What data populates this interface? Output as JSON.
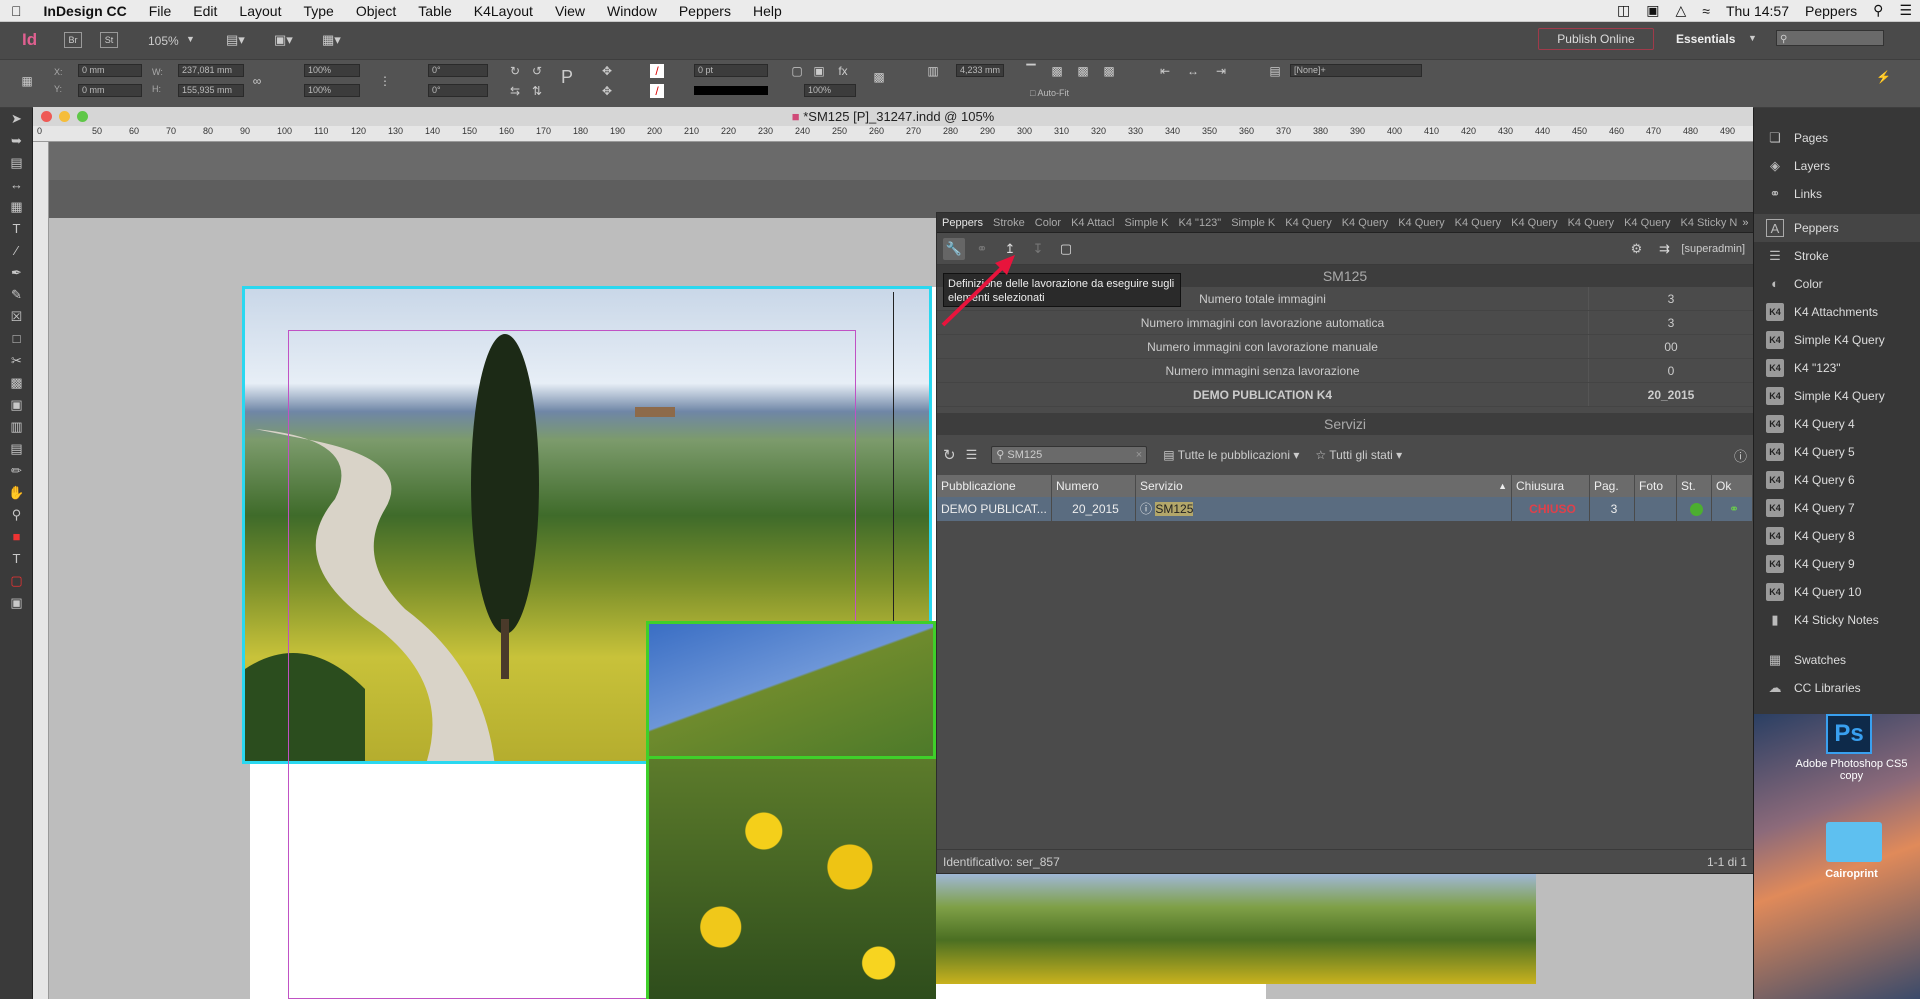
{
  "menubar": {
    "app": "InDesign CC",
    "items": [
      "File",
      "Edit",
      "Layout",
      "Type",
      "Object",
      "Table",
      "K4Layout",
      "View",
      "Window",
      "Peppers",
      "Help"
    ],
    "clock": "Thu 14:57",
    "user": "Peppers"
  },
  "control": {
    "zoom": "105%",
    "x": "0 mm",
    "y": "0 mm",
    "w": "237,081 mm",
    "h": "155,935 mm",
    "scale_x": "100%",
    "scale_y": "100%",
    "rotate": "0°",
    "shear": "0°",
    "stroke_weight": "0 pt",
    "opacity": "100%",
    "gap": "4,233 mm",
    "autofit": "Auto-Fit",
    "style": "[None]+",
    "publish": "Publish Online",
    "workspace": "Essentials"
  },
  "document": {
    "title": "*SM125 [P]_31247.indd @ 105%",
    "ruler": [
      "0",
      "50",
      "60",
      "70",
      "80",
      "90",
      "100",
      "110",
      "120",
      "130",
      "140",
      "150",
      "160",
      "170",
      "180",
      "190",
      "200",
      "210",
      "220",
      "230",
      "240",
      "250",
      "260",
      "270",
      "280",
      "290",
      "300",
      "310",
      "320",
      "330",
      "340",
      "350",
      "360",
      "370",
      "380",
      "390",
      "400",
      "410",
      "420",
      "430",
      "440",
      "450",
      "460",
      "470",
      "480",
      "490"
    ]
  },
  "panel": {
    "tabs": [
      "Peppers",
      "Stroke",
      "Color",
      "K4 Attacl",
      "Simple K",
      "K4 \"123\"",
      "Simple K",
      "K4 Query",
      "K4 Query",
      "K4 Query",
      "K4 Query",
      "K4 Query",
      "K4 Query",
      "K4 Query",
      "K4 Sticky N"
    ],
    "tooltip": "Definizione delle lavorazione da eseguire sugli elementi selezionati",
    "user": "[superadmin]",
    "section1": "SM125",
    "stats": [
      {
        "label": "Numero totale immagini",
        "value": "3"
      },
      {
        "label": "Numero immagini con lavorazione automatica",
        "value": "3"
      },
      {
        "label": "Numero immagini con lavorazione manuale",
        "value": "00"
      },
      {
        "label": "Numero immagini senza lavorazione",
        "value": "0"
      },
      {
        "label": "DEMO PUBLICATION K4",
        "value": "20_2015"
      }
    ],
    "section2": "Servizi",
    "search": "SM125",
    "pub_filter": "Tutte le pubblicazioni",
    "state_filter": "Tutti gli stati",
    "columns": [
      "Pubblicazione",
      "Numero",
      "Servizio",
      "Chiusura",
      "Pag.",
      "Foto",
      "St.",
      "Ok"
    ],
    "row": {
      "pub": "DEMO PUBLICAT...",
      "num": "20_2015",
      "service": "SM125",
      "closing": "CHIUSO",
      "pages": "3",
      "photo": ""
    },
    "footer_id": "Identificativo: ser_857",
    "footer_count": "1-1 di 1"
  },
  "dock": {
    "group1": [
      "Pages",
      "Layers",
      "Links"
    ],
    "group2": [
      "Peppers",
      "Stroke",
      "Color",
      "K4 Attachments",
      "Simple K4 Query",
      "K4 \"123\"",
      "Simple K4 Query",
      "K4 Query   4",
      "K4 Query   5",
      "K4 Query   6",
      "K4 Query   7",
      "K4 Query   8",
      "K4 Query   9",
      "K4 Query   10",
      "K4 Sticky Notes"
    ],
    "group3": [
      "Swatches",
      "CC Libraries"
    ]
  },
  "desktop": {
    "ps_label": "Adobe Photoshop CS5 copy",
    "folder_label": "Cairoprint"
  },
  "colors": {
    "accent_cyan": "#2ad8f0",
    "accent_green": "#3fd02a",
    "closed_red": "#e0404a",
    "arrow": "#e8143c"
  }
}
